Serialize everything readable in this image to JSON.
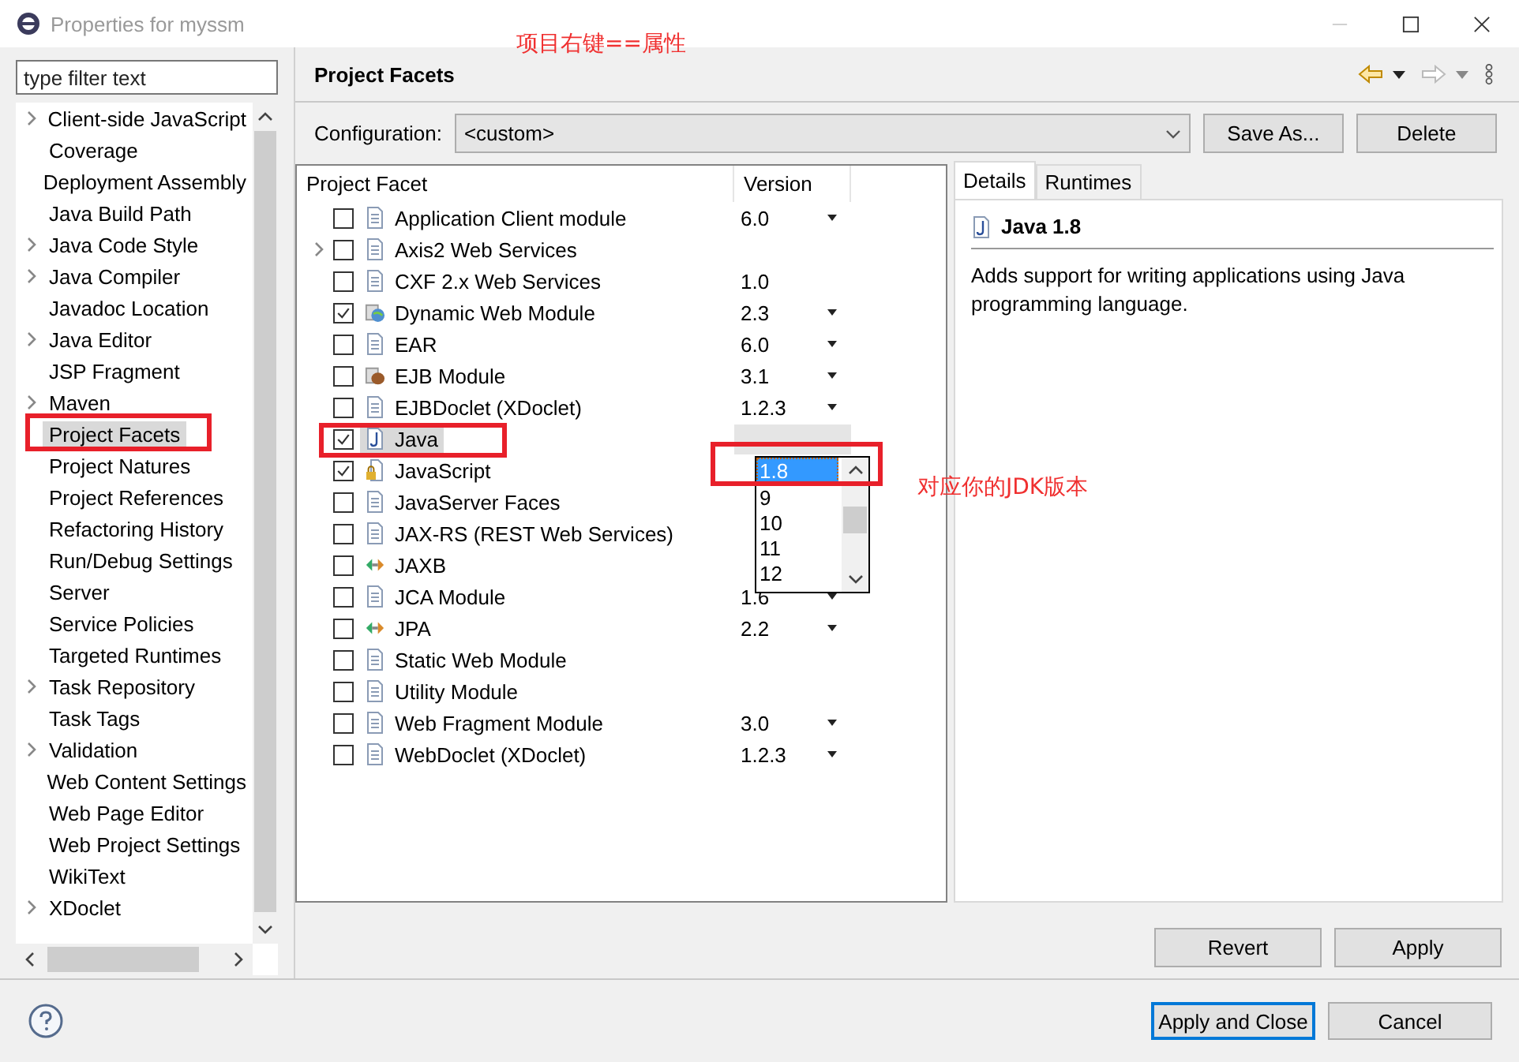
{
  "window": {
    "title": "Properties for myssm"
  },
  "annotations": [
    {
      "text": "项目右键==属性"
    },
    {
      "text": "对应你的JDK版本"
    }
  ],
  "filter": {
    "placeholder": "type filter text"
  },
  "sidebar": {
    "items": [
      {
        "label": "Client-side JavaScript",
        "expandable": true,
        "selected": false
      },
      {
        "label": "Coverage",
        "expandable": false,
        "selected": false
      },
      {
        "label": "Deployment Assembly",
        "expandable": false,
        "selected": false
      },
      {
        "label": "Java Build Path",
        "expandable": false,
        "selected": false
      },
      {
        "label": "Java Code Style",
        "expandable": true,
        "selected": false
      },
      {
        "label": "Java Compiler",
        "expandable": true,
        "selected": false
      },
      {
        "label": "Javadoc Location",
        "expandable": false,
        "selected": false
      },
      {
        "label": "Java Editor",
        "expandable": true,
        "selected": false
      },
      {
        "label": "JSP Fragment",
        "expandable": false,
        "selected": false
      },
      {
        "label": "Maven",
        "expandable": true,
        "selected": false
      },
      {
        "label": "Project Facets",
        "expandable": false,
        "selected": true
      },
      {
        "label": "Project Natures",
        "expandable": false,
        "selected": false
      },
      {
        "label": "Project References",
        "expandable": false,
        "selected": false
      },
      {
        "label": "Refactoring History",
        "expandable": false,
        "selected": false
      },
      {
        "label": "Run/Debug Settings",
        "expandable": false,
        "selected": false
      },
      {
        "label": "Server",
        "expandable": false,
        "selected": false
      },
      {
        "label": "Service Policies",
        "expandable": false,
        "selected": false
      },
      {
        "label": "Targeted Runtimes",
        "expandable": false,
        "selected": false
      },
      {
        "label": "Task Repository",
        "expandable": true,
        "selected": false
      },
      {
        "label": "Task Tags",
        "expandable": false,
        "selected": false
      },
      {
        "label": "Validation",
        "expandable": true,
        "selected": false
      },
      {
        "label": "Web Content Settings",
        "expandable": false,
        "selected": false
      },
      {
        "label": "Web Page Editor",
        "expandable": false,
        "selected": false
      },
      {
        "label": "Web Project Settings",
        "expandable": false,
        "selected": false
      },
      {
        "label": "WikiText",
        "expandable": false,
        "selected": false
      },
      {
        "label": "XDoclet",
        "expandable": true,
        "selected": false
      }
    ]
  },
  "page": {
    "title": "Project Facets"
  },
  "configuration": {
    "label": "Configuration:",
    "value": "<custom>"
  },
  "config_buttons": [
    "Save As...",
    "Delete"
  ],
  "facets_table": {
    "columns": [
      "Project Facet",
      "Version"
    ],
    "rows": [
      {
        "name": "Application Client module",
        "checked": false,
        "kind": "file",
        "version": "6.0",
        "dropdown": true,
        "expandable": false,
        "selected": false
      },
      {
        "name": "Axis2 Web Services",
        "checked": false,
        "kind": "file",
        "dropdown": false,
        "expandable": true,
        "selected": false
      },
      {
        "name": "CXF 2.x Web Services",
        "checked": false,
        "kind": "file",
        "version": "1.0",
        "dropdown": false,
        "expandable": false,
        "selected": false
      },
      {
        "name": "Dynamic Web Module",
        "checked": true,
        "kind": "globe",
        "version": "2.3",
        "dropdown": true,
        "expandable": false,
        "selected": false
      },
      {
        "name": "EAR",
        "checked": false,
        "kind": "file",
        "version": "6.0",
        "dropdown": true,
        "expandable": false,
        "selected": false
      },
      {
        "name": "EJB Module",
        "checked": false,
        "kind": "bean",
        "version": "3.1",
        "dropdown": true,
        "expandable": false,
        "selected": false
      },
      {
        "name": "EJBDoclet (XDoclet)",
        "checked": false,
        "kind": "file",
        "version": "1.2.3",
        "dropdown": true,
        "expandable": false,
        "selected": false
      },
      {
        "name": "Java",
        "checked": true,
        "kind": "java",
        "dropdown": false,
        "expandable": false,
        "selected": true
      },
      {
        "name": "JavaScript",
        "checked": true,
        "kind": "locked-file",
        "dropdown": false,
        "expandable": false,
        "selected": false
      },
      {
        "name": "JavaServer Faces",
        "checked": false,
        "kind": "file",
        "dropdown": false,
        "expandable": false,
        "selected": false
      },
      {
        "name": "JAX-RS (REST Web Services)",
        "checked": false,
        "kind": "file",
        "dropdown": false,
        "expandable": false,
        "selected": false
      },
      {
        "name": "JAXB",
        "checked": false,
        "kind": "arrows",
        "dropdown": false,
        "expandable": false,
        "selected": false
      },
      {
        "name": "JCA Module",
        "checked": false,
        "kind": "file",
        "version": "1.6",
        "dropdown": true,
        "expandable": false,
        "selected": false
      },
      {
        "name": "JPA",
        "checked": false,
        "kind": "arrows",
        "version": "2.2",
        "dropdown": true,
        "expandable": false,
        "selected": false
      },
      {
        "name": "Static Web Module",
        "checked": false,
        "kind": "file",
        "dropdown": false,
        "expandable": false,
        "selected": false
      },
      {
        "name": "Utility Module",
        "checked": false,
        "kind": "file",
        "dropdown": false,
        "expandable": false,
        "selected": false
      },
      {
        "name": "Web Fragment Module",
        "checked": false,
        "kind": "file",
        "version": "3.0",
        "dropdown": true,
        "expandable": false,
        "selected": false
      },
      {
        "name": "WebDoclet (XDoclet)",
        "checked": false,
        "kind": "file",
        "version": "1.2.3",
        "dropdown": true,
        "expandable": false,
        "selected": false
      }
    ]
  },
  "version_dropdown": {
    "options": [
      {
        "label": "1.8",
        "selected": true
      },
      {
        "label": "9",
        "selected": false
      },
      {
        "label": "10",
        "selected": false
      },
      {
        "label": "11",
        "selected": false
      },
      {
        "label": "12",
        "selected": false
      }
    ]
  },
  "details": {
    "tabs": [
      {
        "label": "Details",
        "selected": true
      },
      {
        "label": "Runtimes",
        "selected": false
      }
    ],
    "title": "Java 1.8",
    "description": "Adds support for writing applications using Java programming language."
  },
  "page_buttons": [
    "Revert",
    "Apply"
  ],
  "dialog_buttons": [
    {
      "label": "Apply and Close",
      "default": true
    },
    {
      "label": "Cancel",
      "default": false
    }
  ]
}
